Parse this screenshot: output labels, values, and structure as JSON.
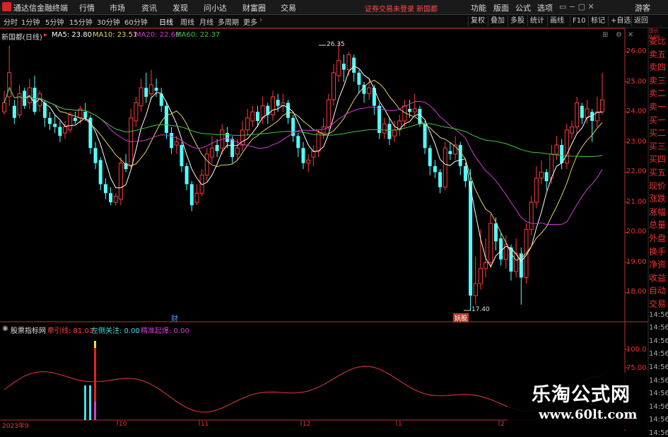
{
  "app": {
    "title": "通达信金融终端"
  },
  "menu": [
    "行情",
    "市场",
    "资讯",
    "发现",
    "问小达",
    "财富圈",
    "交易"
  ],
  "notice": "证券交易未登录  新国都",
  "topright": [
    "功能",
    "版面",
    "公式",
    "选项",
    "游客"
  ],
  "timeframes": [
    "分时",
    "1分钟",
    "5分钟",
    "15分钟",
    "30分钟",
    "60分钟",
    "日线",
    "周线",
    "月线",
    "多周期",
    "更多"
  ],
  "toolbar_right": [
    "复权",
    "叠加",
    "多股",
    "统计",
    "画线",
    "F10",
    "标记",
    "+自选",
    "返回"
  ],
  "chart_title": "新国都(日线)",
  "ma": [
    {
      "label": "MA5: 23.80",
      "color": "#ffffff"
    },
    {
      "label": "MA10: 23.51",
      "color": "#e6d06b"
    },
    {
      "label": "MA20: 22.68",
      "color": "#d23cd2"
    },
    {
      "label": "MA60: 22.37",
      "color": "#3cc83c"
    }
  ],
  "price_axis": [
    "26.00",
    "25.00",
    "24.00",
    "23.00",
    "22.00",
    "21.00",
    "20.00",
    "19.00",
    "18.00"
  ],
  "annotations": {
    "high": "26.35",
    "low": "17.40",
    "cai": "财",
    "badge": "妖股"
  },
  "right_panel": {
    "header": [
      "现价",
      "0.00"
    ],
    "items": [
      "委比",
      "卖五",
      "卖四",
      "卖三",
      "卖二",
      "卖一",
      "买一",
      "买二",
      "买三",
      "买四",
      "买五",
      "现价",
      "涨跌",
      "涨幅",
      "总量",
      "外盘",
      "换手",
      "净资",
      "收益",
      "自动",
      "交易",
      "14:56",
      "14:56",
      "14:56",
      "14:56",
      "14:56",
      "14:56",
      "14:56",
      "14:56",
      "14:56",
      "14:56"
    ]
  },
  "indicator": {
    "name": "股票指标网",
    "items": [
      {
        "label": "牵引线: 81.03",
        "color": "#ff4040"
      },
      {
        "label": "左侧关注: 0.00",
        "color": "#40e0e8"
      },
      {
        "label": "精准起爆: 0.00",
        "color": "#d23cd2"
      }
    ],
    "axis": [
      "100.0",
      "75.00"
    ]
  },
  "date_axis": [
    "2023年9",
    "10",
    "11",
    "12",
    "1",
    "2"
  ],
  "watermark": {
    "cn": "乐淘公式网",
    "url": "www.60lt.com"
  },
  "colors": {
    "up": "#ff3c3c",
    "down": "#54ffff",
    "axis": "#c03030"
  }
}
